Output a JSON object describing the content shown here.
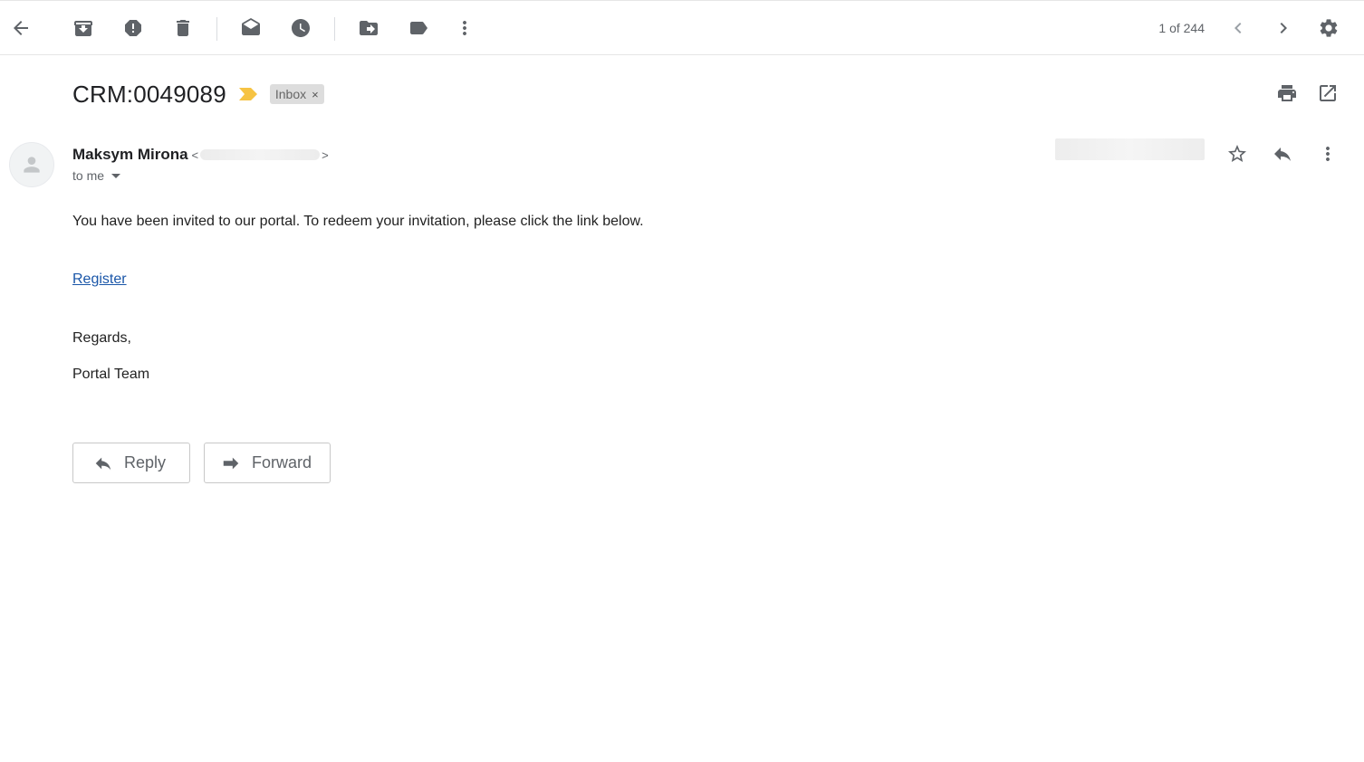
{
  "toolbar": {
    "back_icon": "arrow-left-icon",
    "archive_icon": "archive-icon",
    "spam_icon": "report-spam-icon",
    "delete_icon": "trash-icon",
    "mark_unread_icon": "mark-unread-icon",
    "snooze_icon": "clock-icon",
    "move_icon": "move-to-icon",
    "label_icon": "label-icon",
    "more_icon": "more-vertical-icon",
    "pager": "1 of 244",
    "settings_icon": "gear-icon"
  },
  "email": {
    "subject": "CRM:0049089",
    "label": "Inbox",
    "label_remove": "×",
    "sender_name": "Maksym Mirona",
    "email_open": "<",
    "email_close": ">",
    "recipient": "to me",
    "body": {
      "line1": "You have been invited to our portal. To redeem your invitation, please click the link below.",
      "link": "Register",
      "regards": "Regards,",
      "signature": "Portal Team"
    }
  },
  "actions": {
    "reply": "Reply",
    "forward": "Forward"
  },
  "colors": {
    "importance_marker": "#f6c343",
    "link": "#1a56a8",
    "icon": "#5f6368"
  }
}
